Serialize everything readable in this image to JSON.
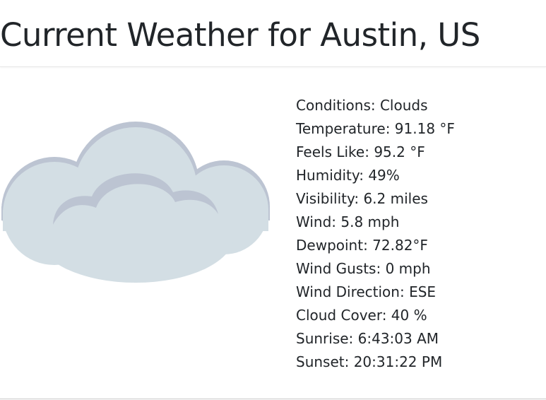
{
  "header": {
    "title": "Current Weather for Austin, US"
  },
  "weather_icon": {
    "name": "cloud-icon",
    "colors": {
      "body": "#d3dee4",
      "shade": "#bcc4d2"
    }
  },
  "details": {
    "conditions": "Conditions: Clouds",
    "temperature": "Temperature: 91.18 °F",
    "feels_like": "Feels Like: 95.2 °F",
    "humidity": "Humidity: 49%",
    "visibility": "Visibility: 6.2 miles",
    "wind": "Wind: 5.8 mph",
    "dewpoint": "Dewpoint: 72.82°F",
    "wind_gusts": "Wind Gusts: 0 mph",
    "wind_direction": "Wind Direction: ESE",
    "cloud_cover": "Cloud Cover: 40 %",
    "sunrise": "Sunrise: 6:43:03 AM",
    "sunset": "Sunset: 20:31:22 PM"
  }
}
